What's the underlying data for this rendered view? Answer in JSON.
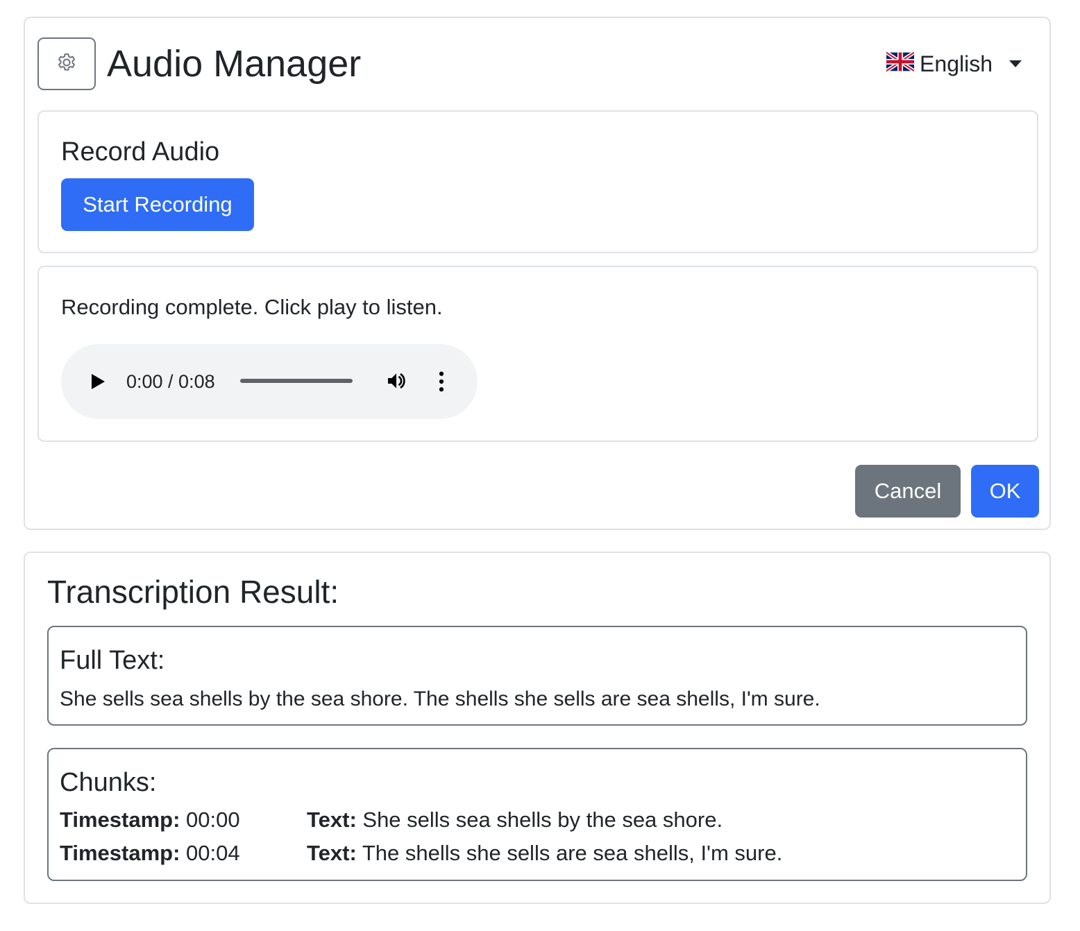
{
  "header": {
    "title": "Audio Manager",
    "settings_icon": "gear-icon",
    "language": {
      "flag_icon": "uk-flag-icon",
      "label": "English"
    }
  },
  "record": {
    "title": "Record Audio",
    "start_button": "Start Recording"
  },
  "playback": {
    "status": "Recording complete. Click play to listen.",
    "player": {
      "time": "0:00 / 0:08",
      "progress": 0,
      "icons": [
        "play-icon",
        "volume-icon",
        "more-options-icon"
      ]
    }
  },
  "actions": {
    "cancel": "Cancel",
    "ok": "OK"
  },
  "result": {
    "title": "Transcription Result:",
    "full_text": {
      "label": "Full Text:",
      "text": "She sells sea shells by the sea shore. The shells she sells are sea shells, I'm sure."
    },
    "chunks": {
      "label": "Chunks:",
      "timestamp_label": "Timestamp:",
      "text_label": "Text:",
      "items": [
        {
          "timestamp": "00:00",
          "text": "She sells sea shells by the sea shore."
        },
        {
          "timestamp": "00:04",
          "text": "The shells she sells are sea shells, I'm sure."
        }
      ]
    }
  },
  "colors": {
    "primary": "#2f6df6",
    "secondary": "#6c757d",
    "border": "#dee2e6",
    "player_bg": "#f1f3f4"
  }
}
